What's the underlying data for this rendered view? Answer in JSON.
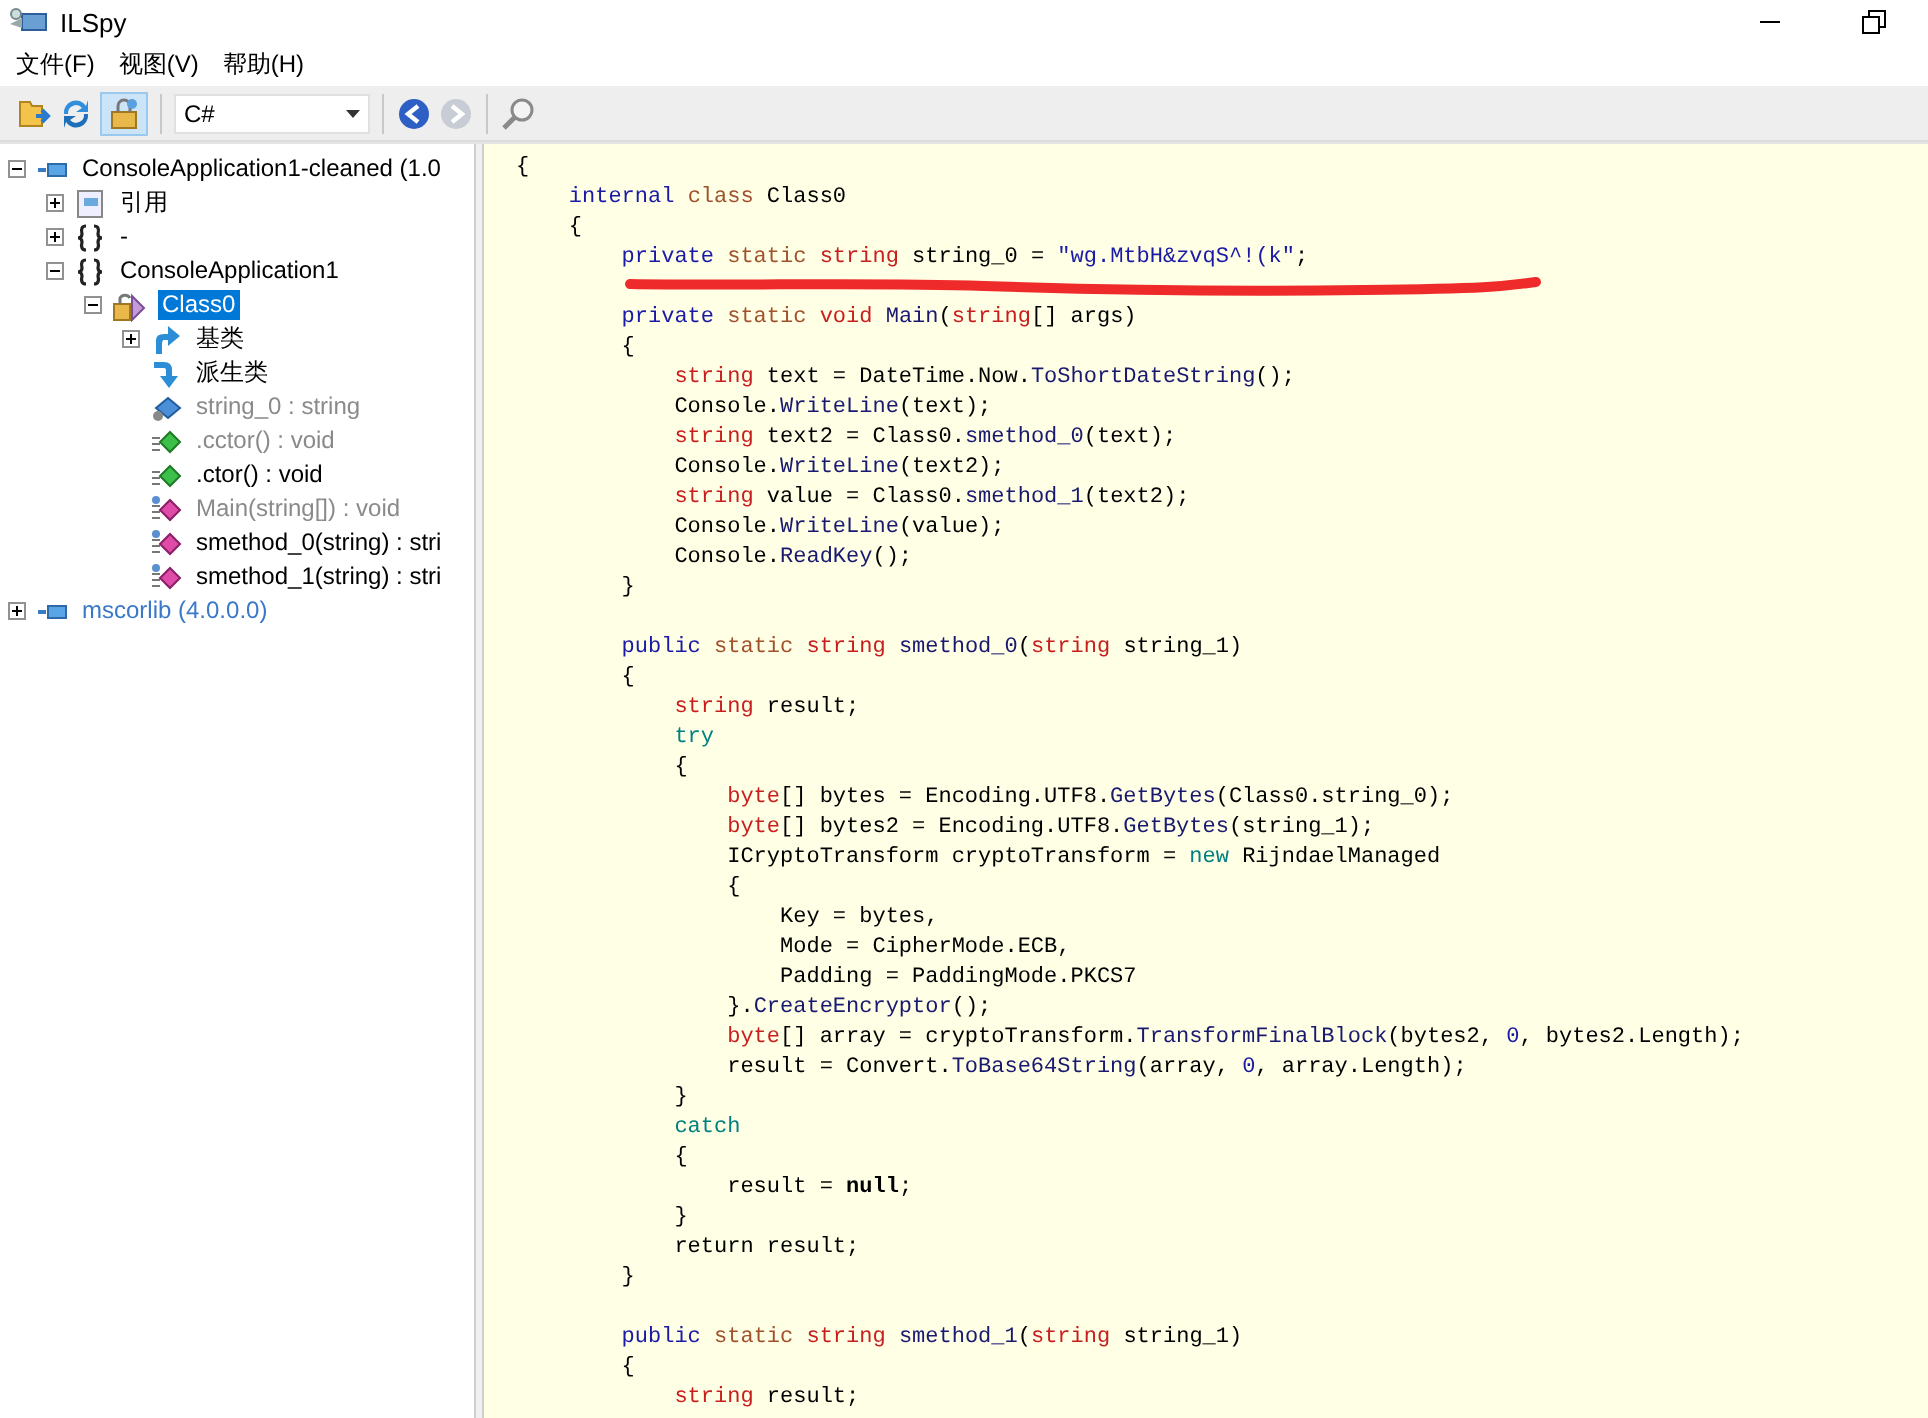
{
  "window": {
    "title": "ILSpy"
  },
  "menu": [
    "文件(F)",
    "视图(V)",
    "帮助(H)"
  ],
  "toolbar": [
    {
      "kind": "open",
      "disabled": false
    },
    {
      "kind": "reload",
      "disabled": false
    },
    {
      "kind": "toggle",
      "pressed": true
    },
    {
      "kind": "language",
      "value": "C#"
    },
    {
      "kind": "back",
      "disabled": false
    },
    {
      "kind": "forward",
      "disabled": true
    },
    {
      "kind": "search",
      "disabled": false
    }
  ],
  "tree": [
    {
      "label": "ConsoleApplication1-cleaned (1.0",
      "kind": "assembly",
      "auto_loaded": false,
      "expanded": true,
      "selected": false,
      "children": [
        {
          "label": "引用",
          "kind": "references",
          "dimmed": false,
          "expanded": false,
          "selected": false
        },
        {
          "label": "-",
          "kind": "namespace",
          "dimmed": false,
          "expanded": false,
          "selected": false
        },
        {
          "label": "ConsoleApplication1",
          "kind": "namespace",
          "dimmed": false,
          "expanded": true,
          "selected": false,
          "children": [
            {
              "label": "Class0",
              "kind": "class",
              "dimmed": false,
              "expanded": true,
              "selected": true,
              "children": [
                {
                  "label": "基类",
                  "kind": "base-types",
                  "dimmed": false,
                  "expanded": false,
                  "selected": false
                },
                {
                  "label": "派生类",
                  "kind": "derived-types",
                  "dimmed": false,
                  "selected": false
                },
                {
                  "label": "string_0 : string",
                  "kind": "field",
                  "dimmed": true,
                  "selected": false
                },
                {
                  "label": ".cctor() : void",
                  "kind": "constructor",
                  "dimmed": true,
                  "selected": false
                },
                {
                  "label": ".ctor() : void",
                  "kind": "constructor",
                  "dimmed": false,
                  "selected": false
                },
                {
                  "label": "Main(string[]) : void",
                  "kind": "method",
                  "dimmed": true,
                  "selected": false
                },
                {
                  "label": "smethod_0(string) : stri",
                  "kind": "method",
                  "dimmed": false,
                  "selected": false
                },
                {
                  "label": "smethod_1(string) : stri",
                  "kind": "method",
                  "dimmed": false,
                  "selected": false
                }
              ]
            }
          ]
        }
      ]
    },
    {
      "label": "mscorlib (4.0.0.0)",
      "kind": "assembly",
      "auto_loaded": true,
      "expanded": false,
      "selected": false
    }
  ],
  "code": [
    {
      "underlined": false,
      "tokens": [
        {
          "kind": "plain",
          "text": "{"
        }
      ]
    },
    {
      "underlined": false,
      "tokens": [
        {
          "kind": "keyword",
          "text": "internal "
        },
        {
          "kind": "modifier",
          "text": "class "
        },
        {
          "kind": "plain",
          "text": "Class0"
        }
      ]
    },
    {
      "underlined": false,
      "tokens": [
        {
          "kind": "plain",
          "text": "{"
        }
      ]
    },
    {
      "underlined": true,
      "tokens": [
        {
          "kind": "keyword",
          "text": "private "
        },
        {
          "kind": "modifier",
          "text": "static "
        },
        {
          "kind": "type",
          "text": "string "
        },
        {
          "kind": "plain",
          "text": "string_0 = "
        },
        {
          "kind": "literal",
          "text": "\"wg.MtbH&zvqS^!(k\""
        },
        {
          "kind": "plain",
          "text": ";"
        }
      ]
    },
    {
      "underlined": false
    },
    {
      "underlined": false,
      "tokens": [
        {
          "kind": "keyword",
          "text": "private "
        },
        {
          "kind": "modifier",
          "text": "static "
        },
        {
          "kind": "type",
          "text": "void "
        },
        {
          "kind": "method",
          "text": "Main"
        },
        {
          "kind": "plain",
          "text": "("
        },
        {
          "kind": "type",
          "text": "string"
        },
        {
          "kind": "plain",
          "text": "[] args)"
        }
      ]
    },
    {
      "underlined": false,
      "tokens": [
        {
          "kind": "plain",
          "text": "{"
        }
      ]
    },
    {
      "underlined": false,
      "tokens": [
        {
          "kind": "type",
          "text": "string "
        },
        {
          "kind": "plain",
          "text": "text = DateTime.Now."
        },
        {
          "kind": "method",
          "text": "ToShortDateString"
        },
        {
          "kind": "plain",
          "text": "();"
        }
      ]
    },
    {
      "underlined": false,
      "tokens": [
        {
          "kind": "plain",
          "text": "Console."
        },
        {
          "kind": "method",
          "text": "WriteLine"
        },
        {
          "kind": "plain",
          "text": "(text);"
        }
      ]
    },
    {
      "underlined": false,
      "tokens": [
        {
          "kind": "type",
          "text": "string "
        },
        {
          "kind": "plain",
          "text": "text2 = Class0."
        },
        {
          "kind": "method",
          "text": "smethod_0"
        },
        {
          "kind": "plain",
          "text": "(text);"
        }
      ]
    },
    {
      "underlined": false,
      "tokens": [
        {
          "kind": "plain",
          "text": "Console."
        },
        {
          "kind": "method",
          "text": "WriteLine"
        },
        {
          "kind": "plain",
          "text": "(text2);"
        }
      ]
    },
    {
      "underlined": false,
      "tokens": [
        {
          "kind": "type",
          "text": "string "
        },
        {
          "kind": "plain",
          "text": "value = Class0."
        },
        {
          "kind": "method",
          "text": "smethod_1"
        },
        {
          "kind": "plain",
          "text": "(text2);"
        }
      ]
    },
    {
      "underlined": false,
      "tokens": [
        {
          "kind": "plain",
          "text": "Console."
        },
        {
          "kind": "method",
          "text": "WriteLine"
        },
        {
          "kind": "plain",
          "text": "(value);"
        }
      ]
    },
    {
      "underlined": false,
      "tokens": [
        {
          "kind": "plain",
          "text": "Console."
        },
        {
          "kind": "method",
          "text": "ReadKey"
        },
        {
          "kind": "plain",
          "text": "();"
        }
      ]
    },
    {
      "underlined": false,
      "tokens": [
        {
          "kind": "plain",
          "text": "}"
        }
      ]
    },
    {
      "underlined": false
    },
    {
      "underlined": false,
      "tokens": [
        {
          "kind": "keyword",
          "text": "public "
        },
        {
          "kind": "modifier",
          "text": "static "
        },
        {
          "kind": "type",
          "text": "string "
        },
        {
          "kind": "method",
          "text": "smethod_0"
        },
        {
          "kind": "plain",
          "text": "("
        },
        {
          "kind": "type",
          "text": "string "
        },
        {
          "kind": "plain",
          "text": "string_1)"
        }
      ]
    },
    {
      "underlined": false,
      "tokens": [
        {
          "kind": "plain",
          "text": "{"
        }
      ]
    },
    {
      "underlined": false,
      "tokens": [
        {
          "kind": "type",
          "text": "string "
        },
        {
          "kind": "plain",
          "text": "result;"
        }
      ]
    },
    {
      "underlined": false,
      "tokens": [
        {
          "kind": "control",
          "text": "try"
        }
      ]
    },
    {
      "underlined": false,
      "tokens": [
        {
          "kind": "plain",
          "text": "{"
        }
      ]
    },
    {
      "underlined": false,
      "tokens": [
        {
          "kind": "type",
          "text": "byte"
        },
        {
          "kind": "plain",
          "text": "[] bytes = Encoding.UTF8."
        },
        {
          "kind": "method",
          "text": "GetBytes"
        },
        {
          "kind": "plain",
          "text": "(Class0.string_0);"
        }
      ]
    },
    {
      "underlined": false,
      "tokens": [
        {
          "kind": "type",
          "text": "byte"
        },
        {
          "kind": "plain",
          "text": "[] bytes2 = Encoding.UTF8."
        },
        {
          "kind": "method",
          "text": "GetBytes"
        },
        {
          "kind": "plain",
          "text": "(string_1);"
        }
      ]
    },
    {
      "underlined": false,
      "tokens": [
        {
          "kind": "plain",
          "text": "ICryptoTransform cryptoTransform = "
        },
        {
          "kind": "control",
          "text": "new "
        },
        {
          "kind": "plain",
          "text": "RijndaelManaged"
        }
      ]
    },
    {
      "underlined": false,
      "tokens": [
        {
          "kind": "plain",
          "text": "{"
        }
      ]
    },
    {
      "underlined": false,
      "tokens": [
        {
          "kind": "plain",
          "text": "Key = bytes,"
        }
      ]
    },
    {
      "underlined": false,
      "tokens": [
        {
          "kind": "plain",
          "text": "Mode = CipherMode.ECB,"
        }
      ]
    },
    {
      "underlined": false,
      "tokens": [
        {
          "kind": "plain",
          "text": "Padding = PaddingMode.PKCS7"
        }
      ]
    },
    {
      "underlined": false,
      "tokens": [
        {
          "kind": "plain",
          "text": "}."
        },
        {
          "kind": "method",
          "text": "CreateEncryptor"
        },
        {
          "kind": "plain",
          "text": "();"
        }
      ]
    },
    {
      "underlined": false,
      "tokens": [
        {
          "kind": "type",
          "text": "byte"
        },
        {
          "kind": "plain",
          "text": "[] array = cryptoTransform."
        },
        {
          "kind": "method",
          "text": "TransformFinalBlock"
        },
        {
          "kind": "plain",
          "text": "(bytes2, "
        },
        {
          "kind": "literal",
          "text": "0"
        },
        {
          "kind": "plain",
          "text": ", bytes2.Length);"
        }
      ]
    },
    {
      "underlined": false,
      "tokens": [
        {
          "kind": "plain",
          "text": "result = Convert."
        },
        {
          "kind": "method",
          "text": "ToBase64String"
        },
        {
          "kind": "plain",
          "text": "(array, "
        },
        {
          "kind": "literal",
          "text": "0"
        },
        {
          "kind": "plain",
          "text": ", array.Length);"
        }
      ]
    },
    {
      "underlined": false,
      "tokens": [
        {
          "kind": "plain",
          "text": "}"
        }
      ]
    },
    {
      "underlined": false,
      "tokens": [
        {
          "kind": "control",
          "text": "catch"
        }
      ]
    },
    {
      "underlined": false,
      "tokens": [
        {
          "kind": "plain",
          "text": "{"
        }
      ]
    },
    {
      "underlined": false,
      "tokens": [
        {
          "kind": "plain",
          "text": "result = "
        },
        {
          "kind": "bold",
          "text": "null"
        },
        {
          "kind": "plain",
          "text": ";"
        }
      ]
    },
    {
      "underlined": false,
      "tokens": [
        {
          "kind": "plain",
          "text": "}"
        }
      ]
    },
    {
      "underlined": false,
      "tokens": [
        {
          "kind": "plain",
          "text": "return result;"
        }
      ]
    },
    {
      "underlined": false,
      "tokens": [
        {
          "kind": "plain",
          "text": "}"
        }
      ]
    },
    {
      "underlined": false
    },
    {
      "underlined": false,
      "tokens": [
        {
          "kind": "keyword",
          "text": "public "
        },
        {
          "kind": "modifier",
          "text": "static "
        },
        {
          "kind": "type",
          "text": "string "
        },
        {
          "kind": "method",
          "text": "smethod_1"
        },
        {
          "kind": "plain",
          "text": "("
        },
        {
          "kind": "type",
          "text": "string "
        },
        {
          "kind": "plain",
          "text": "string_1)"
        }
      ]
    },
    {
      "underlined": false,
      "tokens": [
        {
          "kind": "plain",
          "text": "{"
        }
      ]
    },
    {
      "underlined": false,
      "tokens": [
        {
          "kind": "type",
          "text": "string "
        },
        {
          "kind": "plain",
          "text": "result;"
        }
      ]
    }
  ]
}
